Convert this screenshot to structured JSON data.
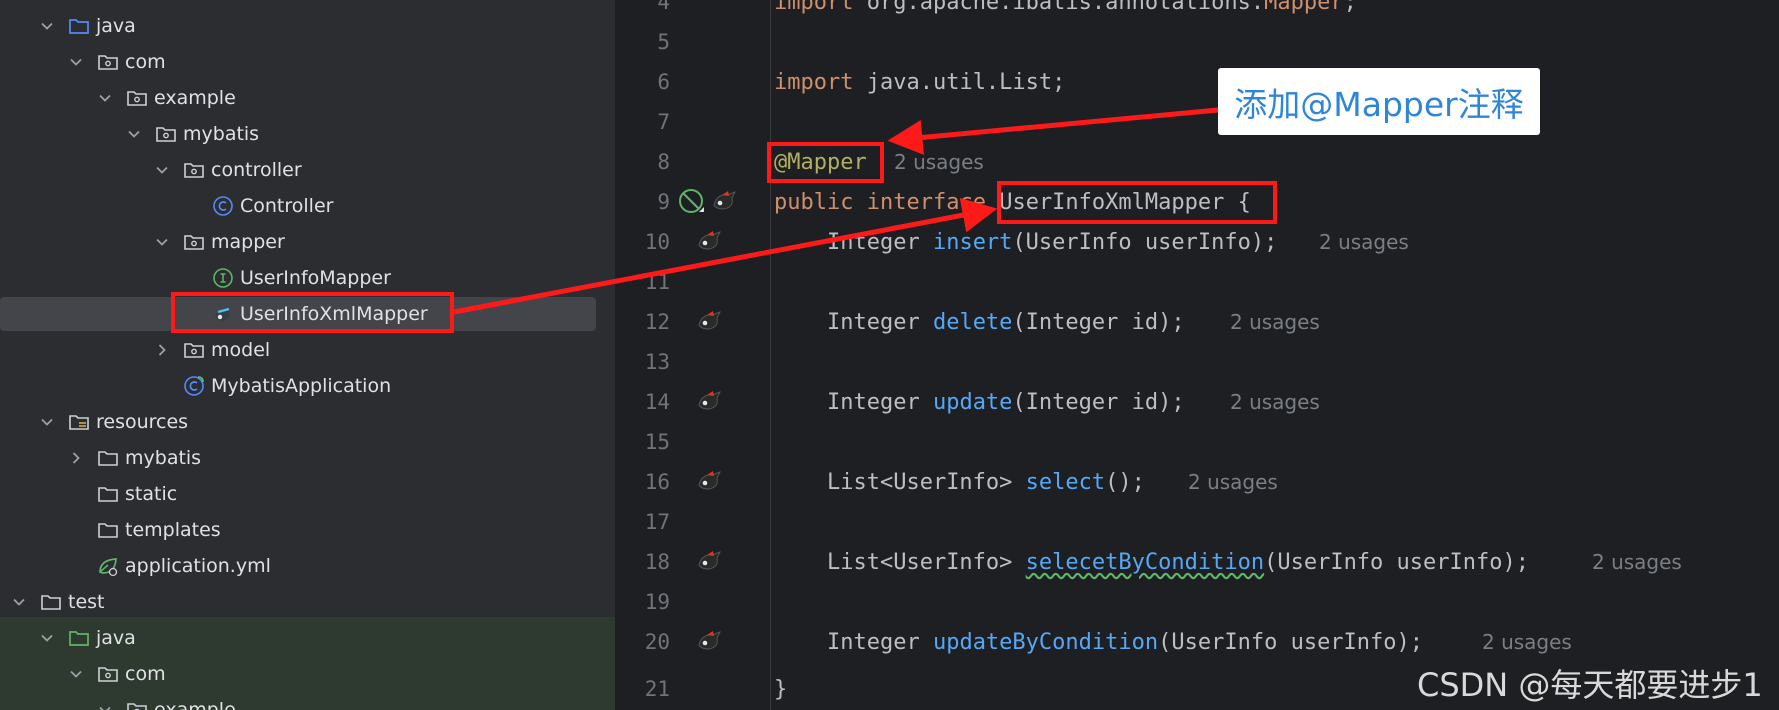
{
  "tree": {
    "items": [
      {
        "label": "java",
        "icon": "source-folder-icon"
      },
      {
        "label": "com",
        "icon": "package-icon"
      },
      {
        "label": "example",
        "icon": "package-icon"
      },
      {
        "label": "mybatis",
        "icon": "package-icon"
      },
      {
        "label": "controller",
        "icon": "package-icon"
      },
      {
        "label": "Controller",
        "icon": "class-icon"
      },
      {
        "label": "mapper",
        "icon": "package-icon"
      },
      {
        "label": "UserInfoMapper",
        "icon": "interface-icon"
      },
      {
        "label": "UserInfoXmlMapper",
        "icon": "mybatis-mapper-icon"
      },
      {
        "label": "model",
        "icon": "package-icon"
      },
      {
        "label": "MybatisApplication",
        "icon": "spring-boot-class-icon"
      },
      {
        "label": "resources",
        "icon": "resources-folder-icon"
      },
      {
        "label": "mybatis",
        "icon": "folder-icon"
      },
      {
        "label": "static",
        "icon": "folder-icon"
      },
      {
        "label": "templates",
        "icon": "folder-icon"
      },
      {
        "label": "application.yml",
        "icon": "spring-config-icon"
      },
      {
        "label": "test",
        "icon": "folder-icon"
      },
      {
        "label": "java",
        "icon": "test-source-folder-icon"
      },
      {
        "label": "com",
        "icon": "package-icon"
      },
      {
        "label": "example",
        "icon": "package-icon"
      }
    ]
  },
  "editor": {
    "line_numbers": [
      "4",
      "5",
      "6",
      "7",
      "8",
      "9",
      "10",
      "11",
      "12",
      "13",
      "14",
      "15",
      "16",
      "17",
      "18",
      "19",
      "20",
      "21"
    ],
    "line4": {
      "kw": "import",
      "rest": " org.apache.ibatis.annotations.",
      "ann": "Mapper",
      "end": ";"
    },
    "line6": {
      "kw": "import",
      "rest": " java.util.List;"
    },
    "line8": {
      "annotation": "@Mapper",
      "usages": "2 usages"
    },
    "line9": {
      "kw1": "public",
      "kw2": "interface",
      "name": "UserInfoXmlMapper",
      "brace": "{"
    },
    "line10": {
      "type": "Integer",
      "method": "insert",
      "args": "(UserInfo userInfo);",
      "usages": "2 usages"
    },
    "line12": {
      "type": "Integer",
      "method": "delete",
      "args": "(Integer id);",
      "usages": "2 usages"
    },
    "line14": {
      "type": "Integer",
      "method": "update",
      "args": "(Integer id);",
      "usages": "2 usages"
    },
    "line16": {
      "type": "List<UserInfo>",
      "method": "select",
      "args": "();",
      "usages": "2 usages"
    },
    "line18": {
      "type": "List<UserInfo>",
      "method": "selecetByCondition",
      "args": "(UserInfo userInfo);",
      "usages": "2 usages"
    },
    "line20": {
      "type": "Integer",
      "method": "updateByCondition",
      "args": "(UserInfo userInfo);",
      "usages": "2 usages"
    },
    "line21": {
      "brace": "}"
    }
  },
  "callout": {
    "text": "添加@Mapper注释"
  },
  "watermark": {
    "text": "CSDN @每天都要进步1"
  },
  "colors": {
    "highlight_red": "#ff1a1a",
    "callout_text": "#2f86d8",
    "keyword": "#cf8e6d",
    "annotation": "#b3ae60",
    "method": "#56a8f5"
  }
}
